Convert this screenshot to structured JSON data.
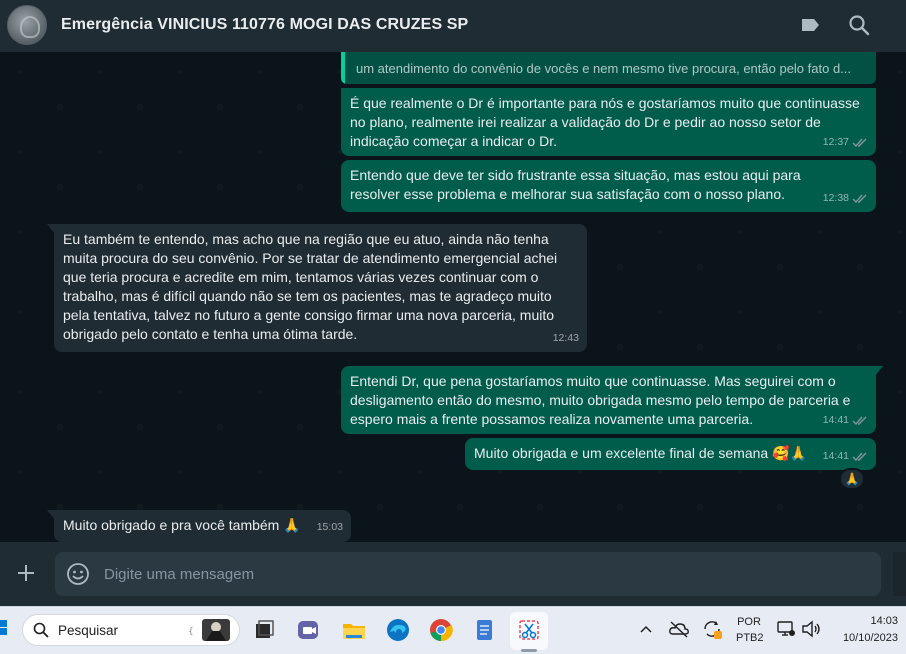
{
  "header": {
    "title": "Emergência VINICIUS 110776 MOGI DAS CRUZES SP"
  },
  "messages": {
    "quoted_text": "um atendimento do convênio de vocês e nem mesmo tive procura, então pelo fato d...",
    "m1": {
      "text": "É que realmente o Dr é importante para nós e gostaríamos muito que continuasse no plano, realmente irei realizar a validação do Dr e pedir ao nosso setor de indicação começar a indicar o Dr.",
      "time": "12:37",
      "status": "read"
    },
    "m2": {
      "text": "Entendo que deve ter sido frustrante essa situação, mas estou aqui para resolver esse problema e melhorar sua satisfação com o nosso plano.",
      "time": "12:38",
      "status": "read"
    },
    "m3": {
      "text": "Eu também te entendo, mas acho que na região que eu atuo, ainda não tenha muita procura do seu convênio. Por se tratar de atendimento emergencial achei que teria procura e acredite em mim, tentamos várias vezes continuar com o trabalho, mas é difícil quando não se tem os pacientes, mas te agradeço muito pela tentativa, talvez no futuro a gente consigo firmar uma nova parceria, muito obrigado pelo contato e tenha uma ótima tarde.",
      "time": "12:43"
    },
    "m4": {
      "text": "Entendi Dr, que pena gostaríamos muito que continuasse. Mas seguirei com o desligamento então do mesmo, muito obrigada mesmo pelo tempo de parceria e espero mais a frente possamos realiza novamente uma parceria.",
      "time": "14:41",
      "status": "read"
    },
    "m5": {
      "text": "Muito obrigada e um excelente final de semana 🥰🙏",
      "time": "14:41",
      "status": "read",
      "reaction": "🙏"
    },
    "m6": {
      "text": "Muito obrigado e pra você também 🙏",
      "time": "15:03"
    }
  },
  "composer": {
    "placeholder": "Digite uma mensagem"
  },
  "taskbar": {
    "search_label": "Pesquisar",
    "language_line1": "POR",
    "language_line2": "PTB2",
    "time": "14:03",
    "date": "10/10/2023"
  },
  "colors": {
    "outgoing_bubble": "#005c4b",
    "incoming_bubble": "#202c33",
    "chat_background": "#0b141a",
    "header": "#202c33",
    "read_ticks": "#8696a0"
  },
  "icons": {
    "header": [
      "label-icon",
      "search-icon"
    ],
    "composer": [
      "plus-icon",
      "emoji-icon"
    ],
    "taskbar_apps": [
      "task-view-icon",
      "teams-icon",
      "file-explorer-icon",
      "edge-icon",
      "chrome-icon",
      "notepad-icon",
      "snipping-tool-icon"
    ]
  }
}
